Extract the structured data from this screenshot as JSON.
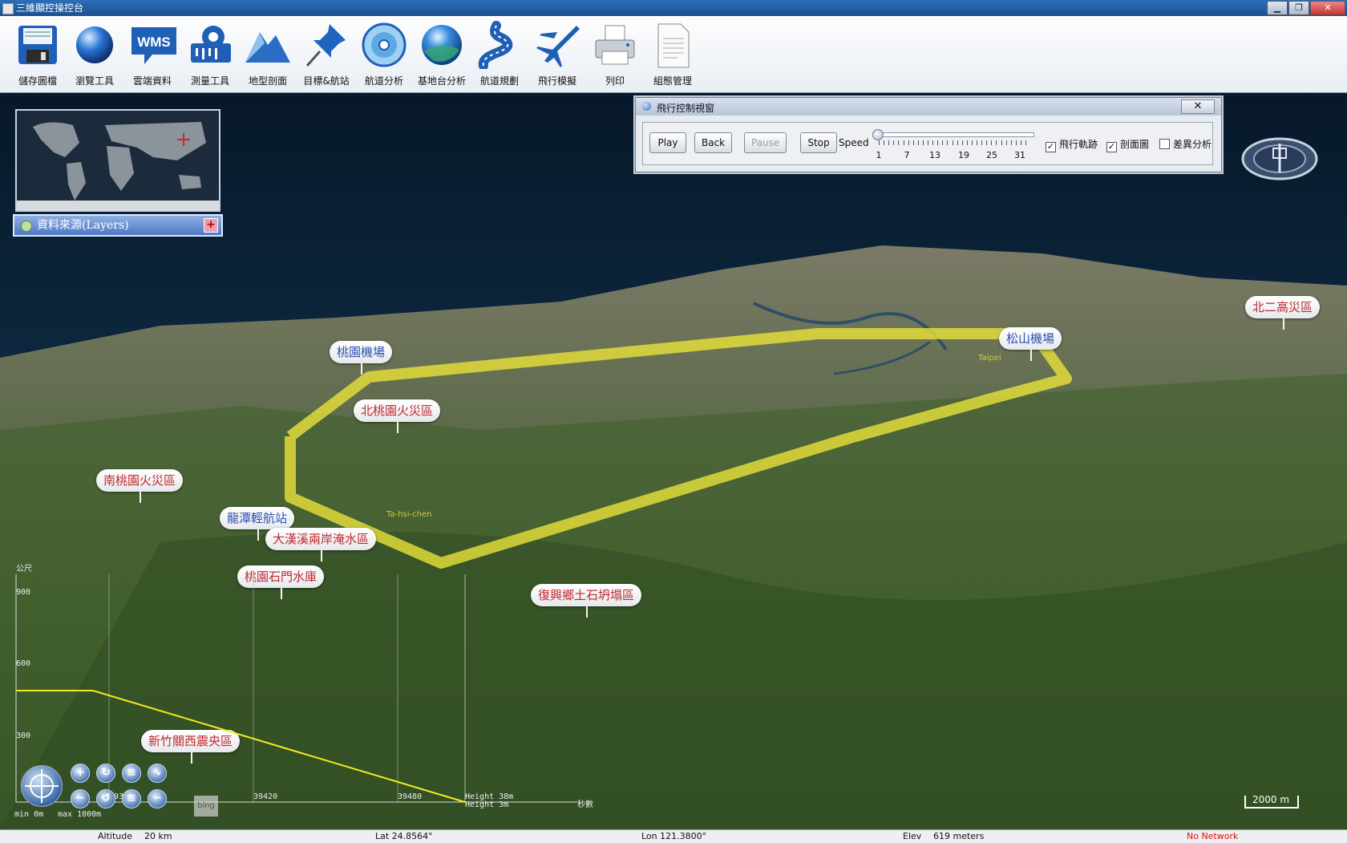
{
  "window": {
    "title": "三維顯控操控台",
    "minimize": "▁",
    "maximize": "❐",
    "close": "✕"
  },
  "toolbar": {
    "items": [
      {
        "label": "儲存圖檔",
        "icon": "floppy-disk-icon"
      },
      {
        "label": "瀏覽工具",
        "icon": "globe-icon"
      },
      {
        "label": "雲端資料",
        "icon": "wms-icon",
        "icon_text": "WMS"
      },
      {
        "label": "測量工具",
        "icon": "measure-ruler-icon"
      },
      {
        "label": "地型剖面",
        "icon": "terrain-profile-icon"
      },
      {
        "label": "目標&航站",
        "icon": "pushpin-icon"
      },
      {
        "label": "航道分析",
        "icon": "disc-icon"
      },
      {
        "label": "基地台分析",
        "icon": "globe-blue-icon"
      },
      {
        "label": "航道規劃",
        "icon": "road-icon"
      },
      {
        "label": "飛行模擬",
        "icon": "airplane-icon"
      },
      {
        "label": "列印",
        "icon": "printer-icon"
      },
      {
        "label": "組態管理",
        "icon": "document-icon"
      }
    ]
  },
  "layers": {
    "label": "資料來源(Layers)",
    "add": "+"
  },
  "flight_dialog": {
    "title": "飛行控制視窗",
    "close": "✕",
    "buttons": {
      "play": "Play",
      "back": "Back",
      "pause": "Pause",
      "stop": "Stop"
    },
    "speed_label": "Speed",
    "speed_value": 1,
    "speed_ticks": [
      "1",
      "7",
      "13",
      "19",
      "25",
      "31"
    ],
    "checks": [
      {
        "label": "飛行軌跡",
        "checked": true
      },
      {
        "label": "剖面圖",
        "checked": true
      },
      {
        "label": "差異分析",
        "checked": false
      }
    ]
  },
  "map": {
    "callouts": [
      {
        "text": "桃園機場",
        "color": "blue"
      },
      {
        "text": "北桃園火災區",
        "color": "red"
      },
      {
        "text": "南桃園火災區",
        "color": "red"
      },
      {
        "text": "龍潭輕航站",
        "color": "blue"
      },
      {
        "text": "大漢溪兩岸淹水區",
        "color": "red"
      },
      {
        "text": "桃園石門水庫",
        "color": "red"
      },
      {
        "text": "復興鄉土石坍塌區",
        "color": "red"
      },
      {
        "text": "松山機場",
        "color": "blue"
      },
      {
        "text": "北二高災區",
        "color": "red"
      },
      {
        "text": "新竹關西震央區",
        "color": "red"
      }
    ],
    "place_labels": [
      "Taipei",
      "Ta-hsi-chen"
    ],
    "flight_path_color": "#e8e23a",
    "bing": "bing",
    "scale": "2000 m"
  },
  "profile": {
    "unit": "公尺",
    "y_ticks": [
      "900",
      "600",
      "300"
    ],
    "x_ticks": [
      "39360",
      "39420",
      "39480"
    ],
    "x_unit": "秒數",
    "min_label": "min 0m",
    "max_label": "max 1000m",
    "height_1": "Height 38m",
    "height_2": "Height 3m",
    "line_color": "#f2ea24"
  },
  "status": {
    "altitude_label": "Altitude",
    "altitude_value": "20 km",
    "lat": "Lat 24.8564°",
    "lon": "Lon 121.3800°",
    "elev_label": "Elev",
    "elev_value": "619 meters",
    "network": "No Network"
  }
}
